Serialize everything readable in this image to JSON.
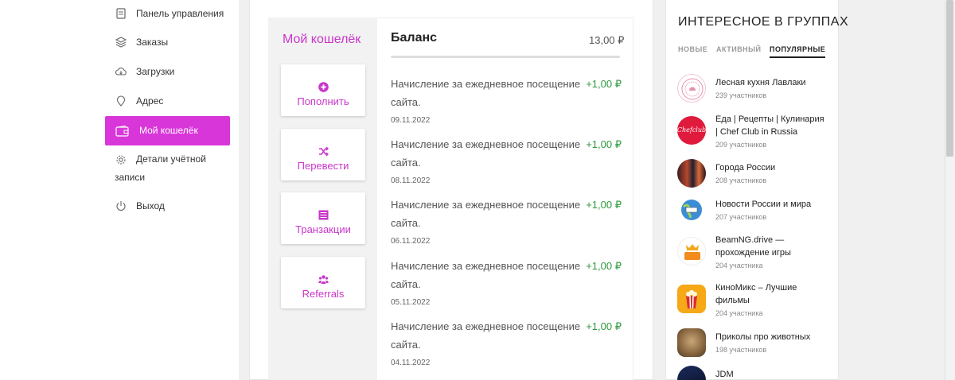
{
  "nav": {
    "items": [
      {
        "label": "Панель управления",
        "icon": "dashboard-icon"
      },
      {
        "label": "Заказы",
        "icon": "orders-icon"
      },
      {
        "label": "Загрузки",
        "icon": "download-cloud-icon"
      },
      {
        "label": "Адрес",
        "icon": "location-pin-icon"
      },
      {
        "label": "Мой кошелёк",
        "icon": "wallet-icon",
        "active": true
      },
      {
        "label_line1": "Детали учётной",
        "label_line2": "записи",
        "icon": "gear-icon"
      },
      {
        "label": "Выход",
        "icon": "power-icon"
      }
    ]
  },
  "wallet": {
    "title": "Мой кошелёк",
    "buttons": [
      {
        "label": "Пополнить",
        "icon": "plus-circle-icon"
      },
      {
        "label": "Перевести",
        "icon": "shuffle-icon"
      },
      {
        "label": "Транзакции",
        "icon": "list-icon"
      },
      {
        "label": "Referrals",
        "icon": "users-icon"
      }
    ],
    "balance_label": "Баланс",
    "balance_value": "13,00 ₽",
    "transactions": [
      {
        "desc": "Начисление за ежедневное посещение сайта.",
        "amount": "+1,00 ₽",
        "date": "09.11.2022"
      },
      {
        "desc": "Начисление за ежедневное посещение сайта.",
        "amount": "+1,00 ₽",
        "date": "08.11.2022"
      },
      {
        "desc": "Начисление за ежедневное посещение сайта.",
        "amount": "+1,00 ₽",
        "date": "06.11.2022"
      },
      {
        "desc": "Начисление за ежедневное посещение сайта.",
        "amount": "+1,00 ₽",
        "date": "05.11.2022"
      },
      {
        "desc": "Начисление за ежедневное посещение сайта.",
        "amount": "+1,00 ₽",
        "date": "04.11.2022"
      }
    ]
  },
  "groups": {
    "title": "ИНТЕРЕСНОЕ В ГРУППАХ",
    "tabs": [
      {
        "label": "НОВЫЕ"
      },
      {
        "label": "АКТИВНЫЙ"
      },
      {
        "label": "ПОПУЛЯРНЫЕ",
        "active": true
      }
    ],
    "items": [
      {
        "name": "Лесная кухня Лавлаки",
        "count": "239 участников"
      },
      {
        "name": "Еда | Рецепты | Кулинария | Chef Club in Russia",
        "count": "209 участников"
      },
      {
        "name": "Города России",
        "count": "208 участников"
      },
      {
        "name": "Новости России и мира",
        "count": "207 участников"
      },
      {
        "name": "BeamNG.drive — прохождение игры",
        "count": "204 участника"
      },
      {
        "name": "КиноМикс – Лучшие фильмы",
        "count": "204 участника"
      },
      {
        "name": "Приколы про животных",
        "count": "198 участников"
      },
      {
        "name": "JDM",
        "count": ""
      }
    ],
    "logo_text": {
      "chefclub": "Chefclub"
    }
  },
  "colors": {
    "accent": "#d936d9",
    "accent_text": "#c936c9",
    "positive": "#2e9a3e"
  }
}
